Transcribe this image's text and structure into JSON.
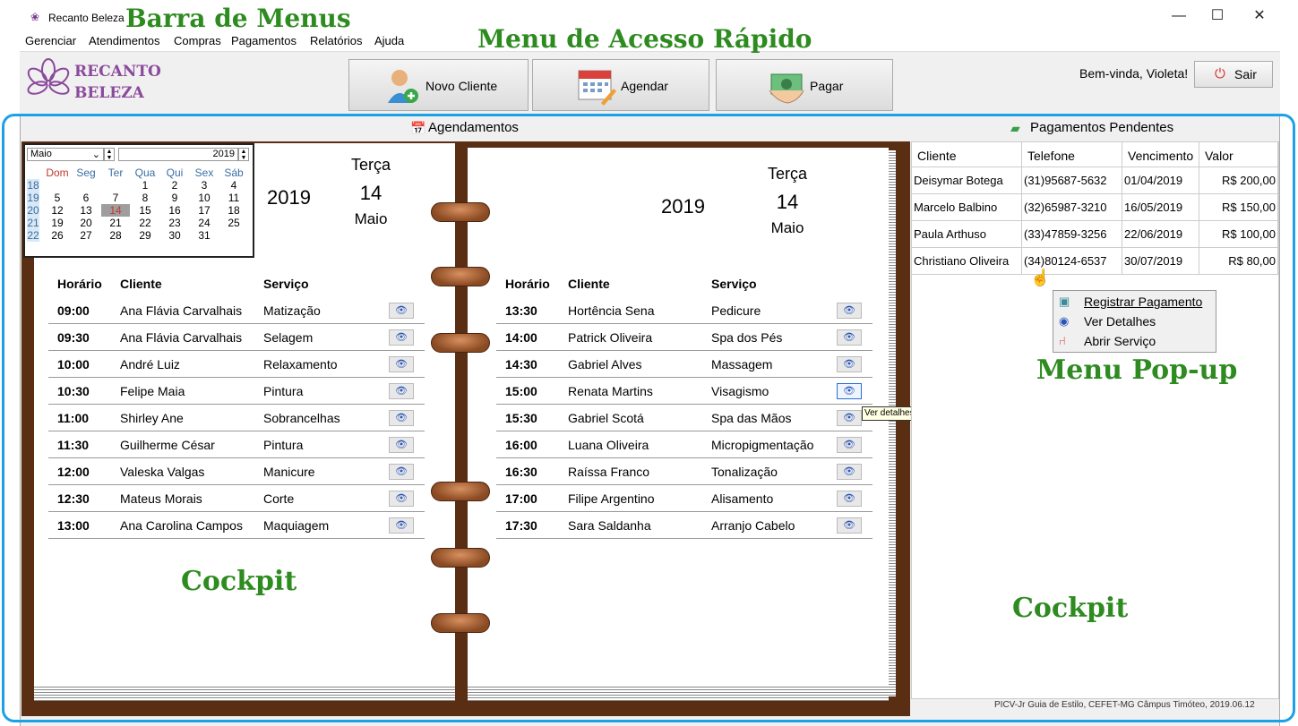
{
  "window": {
    "title": "Recanto Beleza",
    "minimize": "—",
    "maximize": "☐",
    "close": "✕"
  },
  "menu": [
    "Gerenciar",
    "Atendimentos",
    "Compras",
    "Pagamentos",
    "Relatórios",
    "Ajuda"
  ],
  "logo": {
    "line1": "RECANTO",
    "line2": "BELEZA"
  },
  "quick": {
    "novo_cliente": "Novo Cliente",
    "agendar": "Agendar",
    "pagar": "Pagar"
  },
  "user": {
    "welcome": "Bem-vinda, Violeta!",
    "sair": "Sair"
  },
  "annotations": {
    "barra_menus": "Barra de Menus",
    "menu_rapido": "Menu de Acesso Rápido",
    "menu_popup": "Menu Pop-up",
    "cockpit_left": "Cockpit",
    "cockpit_right": "Cockpit"
  },
  "sections": {
    "agendamentos": "Agendamentos",
    "pagamentos": "Pagamentos Pendentes"
  },
  "calendar": {
    "month": "Maio",
    "year": "2019",
    "weekdays": [
      "Dom",
      "Seg",
      "Ter",
      "Qua",
      "Qui",
      "Sex",
      "Sáb"
    ],
    "weeks": [
      {
        "wk": "18",
        "days": [
          "",
          "",
          "",
          "1",
          "2",
          "3",
          "4"
        ]
      },
      {
        "wk": "19",
        "days": [
          "5",
          "6",
          "7",
          "8",
          "9",
          "10",
          "11"
        ]
      },
      {
        "wk": "20",
        "days": [
          "12",
          "13",
          "14",
          "15",
          "16",
          "17",
          "18"
        ]
      },
      {
        "wk": "21",
        "days": [
          "19",
          "20",
          "21",
          "22",
          "23",
          "24",
          "25"
        ]
      },
      {
        "wk": "22",
        "days": [
          "26",
          "27",
          "28",
          "29",
          "30",
          "31",
          ""
        ]
      }
    ],
    "selected": "14"
  },
  "left_page": {
    "year": "2019",
    "dayname": "Terça",
    "day": "14",
    "month": "Maio"
  },
  "right_page": {
    "year": "2019",
    "dayname": "Terça",
    "day": "14",
    "month": "Maio"
  },
  "table_headers": {
    "horario": "Horário",
    "cliente": "Cliente",
    "servico": "Serviço"
  },
  "left_rows": [
    [
      "09:00",
      "Ana Flávia Carvalhais",
      "Matização"
    ],
    [
      "09:30",
      "Ana Flávia Carvalhais",
      "Selagem"
    ],
    [
      "10:00",
      "André Luiz",
      "Relaxamento"
    ],
    [
      "10:30",
      "Felipe Maia",
      "Pintura"
    ],
    [
      "11:00",
      "Shirley Ane",
      "Sobrancelhas"
    ],
    [
      "11:30",
      "Guilherme César",
      "Pintura"
    ],
    [
      "12:00",
      "Valeska Valgas",
      "Manicure"
    ],
    [
      "12:30",
      "Mateus Morais",
      "Corte"
    ],
    [
      "13:00",
      "Ana Carolina Campos",
      "Maquiagem"
    ]
  ],
  "right_rows": [
    [
      "13:30",
      "Hortência Sena",
      "Pedicure"
    ],
    [
      "14:00",
      "Patrick Oliveira",
      "Spa dos Pés"
    ],
    [
      "14:30",
      "Gabriel Alves",
      "Massagem"
    ],
    [
      "15:00",
      "Renata Martins",
      "Visagismo"
    ],
    [
      "15:30",
      "Gabriel Scotá",
      "Spa das Mãos"
    ],
    [
      "16:00",
      "Luana Oliveira",
      "Micropigmentação"
    ],
    [
      "16:30",
      "Raíssa Franco",
      "Tonalização"
    ],
    [
      "17:00",
      "Filipe Argentino",
      "Alisamento"
    ],
    [
      "17:30",
      "Sara Saldanha",
      "Arranjo Cabelo"
    ]
  ],
  "tooltip": "Ver detalhes",
  "payments": {
    "headers": [
      "Cliente",
      "Telefone",
      "Vencimento",
      "Valor"
    ],
    "rows": [
      [
        "Deisymar Botega",
        "(31)95687-5632",
        "01/04/2019",
        "R$ 200,00"
      ],
      [
        "Marcelo Balbino",
        "(32)65987-3210",
        "16/05/2019",
        "R$ 150,00"
      ],
      [
        "Paula Arthuso",
        "(33)47859-3256",
        "22/06/2019",
        "R$ 100,00"
      ],
      [
        "Christiano Oliveira",
        "(34)80124-6537",
        "30/07/2019",
        "R$ 80,00"
      ]
    ]
  },
  "popup": [
    "Registrar Pagamento",
    "Ver Detalhes",
    "Abrir Serviço"
  ],
  "footer": "PICV-Jr Guia de Estilo, CEFET-MG Câmpus Timóteo, 2019.06.12"
}
